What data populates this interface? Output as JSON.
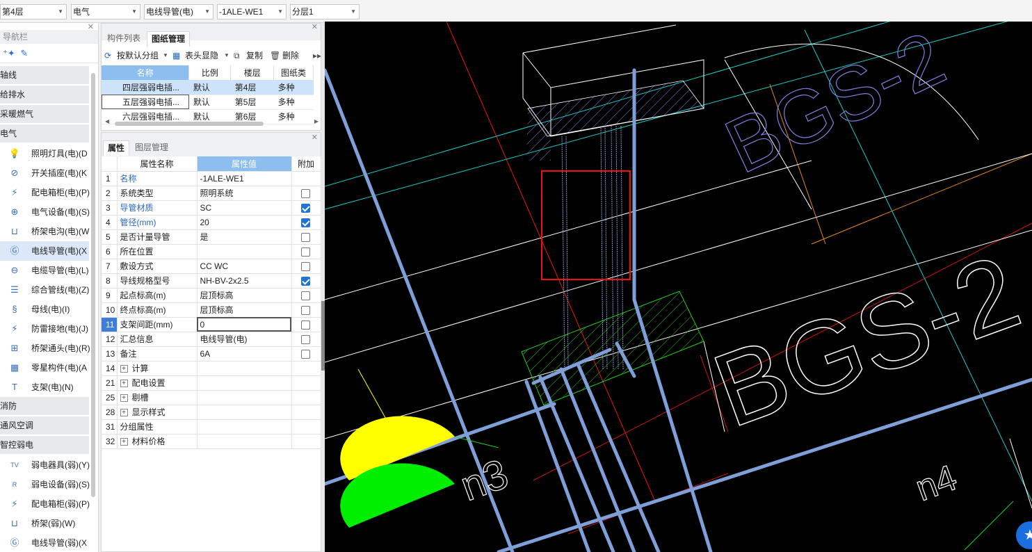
{
  "toolbar": {
    "floor": "第4层",
    "discipline": "电气",
    "component_type": "电线导管(电)",
    "component_name": "-1ALE-WE1",
    "layer": "分层1"
  },
  "nav": {
    "title": "导航栏",
    "categories": {
      "axis": "轴线",
      "water": "给排水",
      "heating": "采暖燃气",
      "electric": "电气",
      "fire": "消防",
      "hvac": "通风空调",
      "smart": "智控弱电"
    },
    "electric_items": [
      "照明灯具(电)(D",
      "开关插座(电)(K",
      "配电箱柜(电)(P)",
      "电气设备(电)(S)",
      "桥架电沟(电)(W",
      "电线导管(电)(X",
      "电缆导管(电)(L)",
      "综合管线(电)(Z)",
      "母线(电)(I)",
      "防雷接地(电)(J)",
      "桥架通头(电)(R)",
      "零星构件(电)(A",
      "支架(电)(N)"
    ],
    "smart_items": [
      "弱电器具(弱)(Y)",
      "弱电设备(弱)(S)",
      "配电箱柜(弱)(P)",
      "桥架(弱)(W)",
      "电线导管(弱)(X"
    ]
  },
  "drawing_panel": {
    "tabs": [
      "构件列表",
      "图纸管理"
    ],
    "actions": {
      "group": "按默认分组",
      "header": "表头显隐",
      "copy": "复制",
      "delete": "删除"
    },
    "columns": [
      "名称",
      "比例",
      "楼层",
      "图纸类"
    ],
    "rows": [
      [
        "四层强弱电插...",
        "默认",
        "第4层",
        "多种"
      ],
      [
        "五层强弱电插...",
        "默认",
        "第5层",
        "多种"
      ],
      [
        "六层强弱电插...",
        "默认",
        "第6层",
        "多种"
      ]
    ]
  },
  "props_panel": {
    "tabs": [
      "属性",
      "图层管理"
    ],
    "columns": [
      "属性名称",
      "属性值",
      "附加"
    ],
    "rows": [
      {
        "n": "1",
        "name": "名称",
        "value": "-1ALE-WE1"
      },
      {
        "n": "2",
        "name": "系统类型",
        "value": "照明系统"
      },
      {
        "n": "3",
        "name": "导管材质",
        "value": "SC"
      },
      {
        "n": "4",
        "name": "管径(mm)",
        "value": "20"
      },
      {
        "n": "5",
        "name": "是否计量导管",
        "value": "是"
      },
      {
        "n": "6",
        "name": "所在位置",
        "value": ""
      },
      {
        "n": "7",
        "name": "敷设方式",
        "value": "CC WC"
      },
      {
        "n": "8",
        "name": "导线规格型号",
        "value": "NH-BV-2x2.5"
      },
      {
        "n": "9",
        "name": "起点标高(m)",
        "value": "层顶标高"
      },
      {
        "n": "10",
        "name": "终点标高(m)",
        "value": "层顶标高"
      },
      {
        "n": "11",
        "name": "支架间距(mm)",
        "value": "0"
      },
      {
        "n": "12",
        "name": "汇总信息",
        "value": "电线导管(电)"
      },
      {
        "n": "13",
        "name": "备注",
        "value": "6A"
      },
      {
        "n": "14",
        "name": "计算",
        "value": ""
      },
      {
        "n": "21",
        "name": "配电设置",
        "value": ""
      },
      {
        "n": "25",
        "name": "剔槽",
        "value": ""
      },
      {
        "n": "28",
        "name": "显示样式",
        "value": ""
      },
      {
        "n": "31",
        "name": "分组属性",
        "value": ""
      },
      {
        "n": "32",
        "name": "材料价格",
        "value": ""
      }
    ]
  },
  "canvas": {
    "label_bgs_top": "BGS-2",
    "label_bgs_main": "BGS-2",
    "label_n3": "n3",
    "label_n4": "n4"
  }
}
